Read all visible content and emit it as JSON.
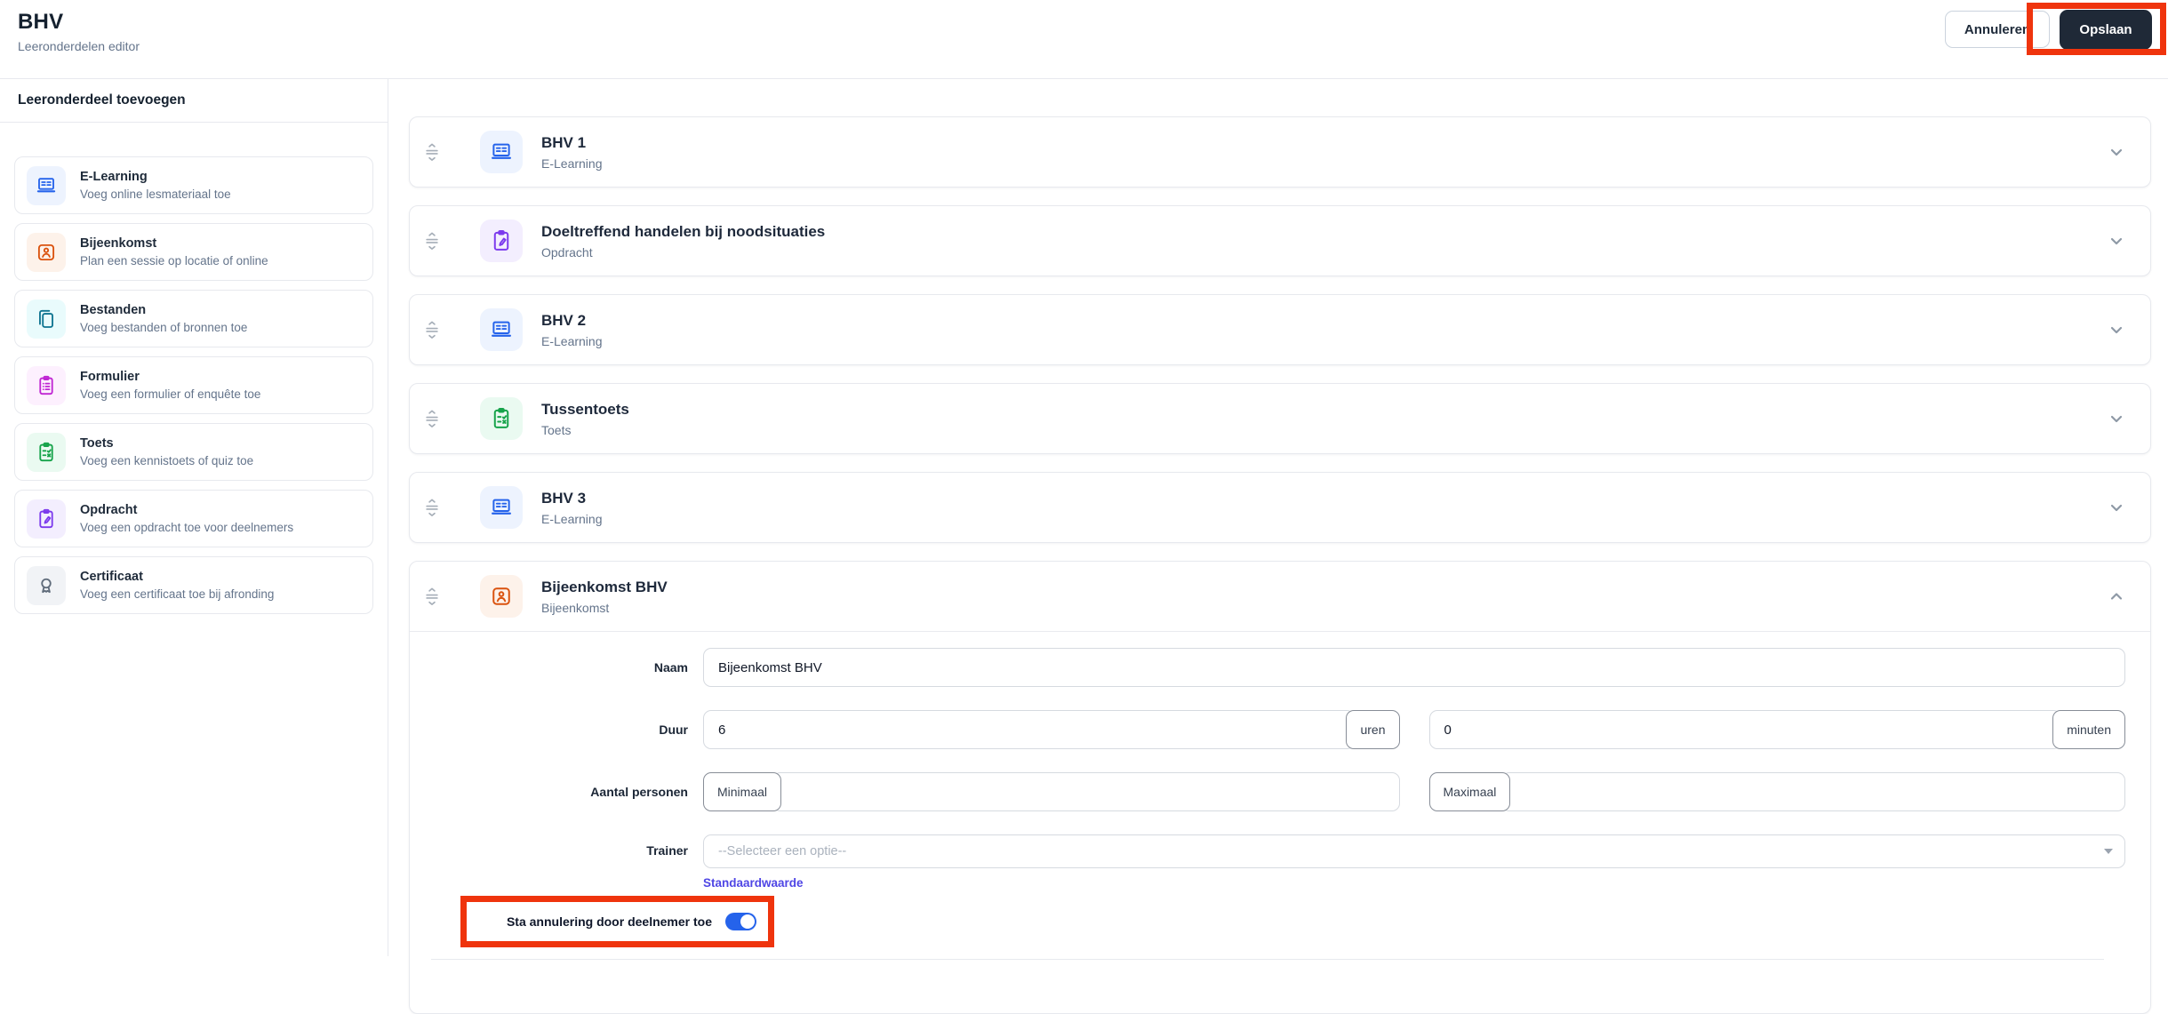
{
  "header": {
    "title": "BHV",
    "subtitle": "Leeronderdelen editor",
    "cancel_label": "Annuleren",
    "save_label": "Opslaan"
  },
  "annotations": {
    "color": "#ef340d",
    "save_button_highlighted": true,
    "cancellation_toggle_highlighted": true
  },
  "sidebar": {
    "title": "Leeronderdeel toevoegen",
    "items": [
      {
        "id": "e-learning",
        "label": "E-Learning",
        "description": "Voeg online lesmateriaal toe",
        "icon": "elearning-icon",
        "color": "#2563eb",
        "bg": "#edf3fe"
      },
      {
        "id": "bijeenkomst",
        "label": "Bijeenkomst",
        "description": "Plan een sessie op locatie of online",
        "icon": "meeting-icon",
        "color": "#da520e",
        "bg": "#fdf2ea"
      },
      {
        "id": "bestanden",
        "label": "Bestanden",
        "description": "Voeg bestanden of bronnen toe",
        "icon": "files-icon",
        "color": "#0e7490",
        "bg": "#e9fbfc"
      },
      {
        "id": "formulier",
        "label": "Formulier",
        "description": "Voeg een formulier of enquête toe",
        "icon": "form-icon",
        "color": "#c026d3",
        "bg": "#fdf0fe"
      },
      {
        "id": "toets",
        "label": "Toets",
        "description": "Voeg een kennistoets of quiz toe",
        "icon": "quiz-icon",
        "color": "#16a34a",
        "bg": "#eafaf1"
      },
      {
        "id": "opdracht",
        "label": "Opdracht",
        "description": "Voeg een opdracht toe voor deelnemers",
        "icon": "assignment-icon",
        "color": "#7c3aed",
        "bg": "#f3eefe"
      },
      {
        "id": "certificaat",
        "label": "Certificaat",
        "description": "Voeg een certificaat toe bij afronding",
        "icon": "certificate-icon",
        "color": "#5f6b7a",
        "bg": "#f1f3f6"
      }
    ]
  },
  "main": {
    "rows": [
      {
        "id": "bhv-1",
        "title": "BHV 1",
        "type": "E-Learning",
        "icon": "elearning-icon",
        "color": "#2563eb",
        "bg": "#edf3fe"
      },
      {
        "id": "doeltreffend-handelen",
        "title": "Doeltreffend handelen bij noodsituaties",
        "type": "Opdracht",
        "icon": "assignment-icon",
        "color": "#7c3aed",
        "bg": "#f3eefe"
      },
      {
        "id": "bhv-2",
        "title": "BHV 2",
        "type": "E-Learning",
        "icon": "elearning-icon",
        "color": "#2563eb",
        "bg": "#edf3fe"
      },
      {
        "id": "tussentoets",
        "title": "Tussentoets",
        "type": "Toets",
        "icon": "quiz-icon",
        "color": "#16a34a",
        "bg": "#eafaf1"
      },
      {
        "id": "bhv-3",
        "title": "BHV 3",
        "type": "E-Learning",
        "icon": "elearning-icon",
        "color": "#2563eb",
        "bg": "#edf3fe"
      }
    ],
    "expanded": {
      "title": "Bijeenkomst BHV",
      "type": "Bijeenkomst",
      "icon": "meeting-icon",
      "color": "#da520e",
      "bg": "#fdf2ea"
    }
  },
  "form": {
    "name_label": "Naam",
    "name_value": "Bijeenkomst BHV",
    "duration_label": "Duur",
    "duration_hours": "6",
    "hours_suffix": "uren",
    "duration_minutes": "0",
    "minutes_suffix": "minuten",
    "people_label": "Aantal personen",
    "min_label": "Minimaal",
    "min_value": "",
    "max_label": "Maximaal",
    "max_value": "",
    "trainer_label": "Trainer",
    "trainer_placeholder": "--Selecteer een optie--",
    "default_value_link": "Standaardwaarde",
    "cancellation_toggle_label": "Sta annulering door deelnemer toe",
    "cancellation_toggle_on": true
  }
}
